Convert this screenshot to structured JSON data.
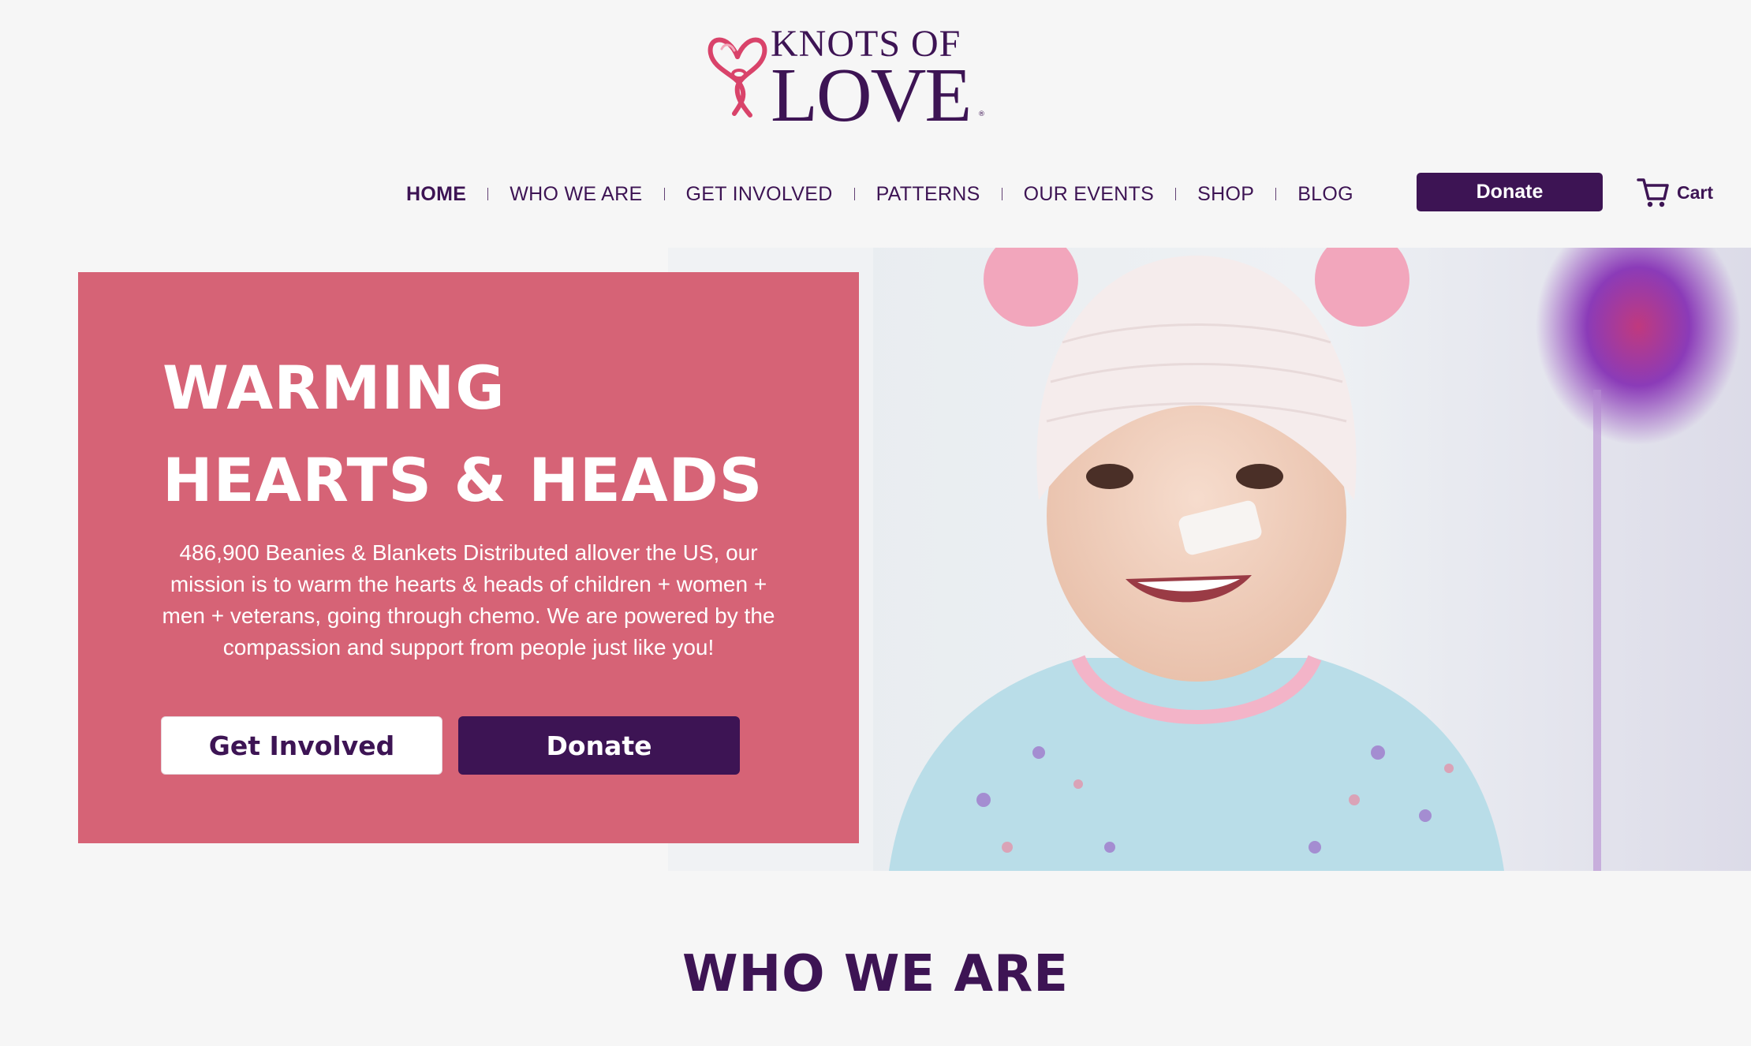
{
  "brand": {
    "line1": "KNOTS OF",
    "line2": "LOVE",
    "registered": "®",
    "primary_color": "#3d1454",
    "accent_color": "#d66376"
  },
  "nav": {
    "items": [
      {
        "label": "HOME",
        "active": true
      },
      {
        "label": "WHO WE ARE"
      },
      {
        "label": "GET INVOLVED"
      },
      {
        "label": "PATTERNS"
      },
      {
        "label": "OUR EVENTS"
      },
      {
        "label": "SHOP"
      },
      {
        "label": "BLOG"
      }
    ],
    "donate_label": "Donate",
    "cart_label": "Cart",
    "cart_icon": "cart-icon"
  },
  "hero": {
    "title_line1": "WARMING",
    "title_line2": "HEARTS & HEADS",
    "text": "486,900 Beanies & Blankets Distributed allover the US, our mission is to warm the hearts & heads of children + women + men + veterans, going through chemo. We are powered by the compassion and support from people just like you!",
    "get_involved_label": "Get Involved",
    "donate_label": "Donate"
  },
  "sections": {
    "who_we_are": "WHO WE ARE"
  }
}
